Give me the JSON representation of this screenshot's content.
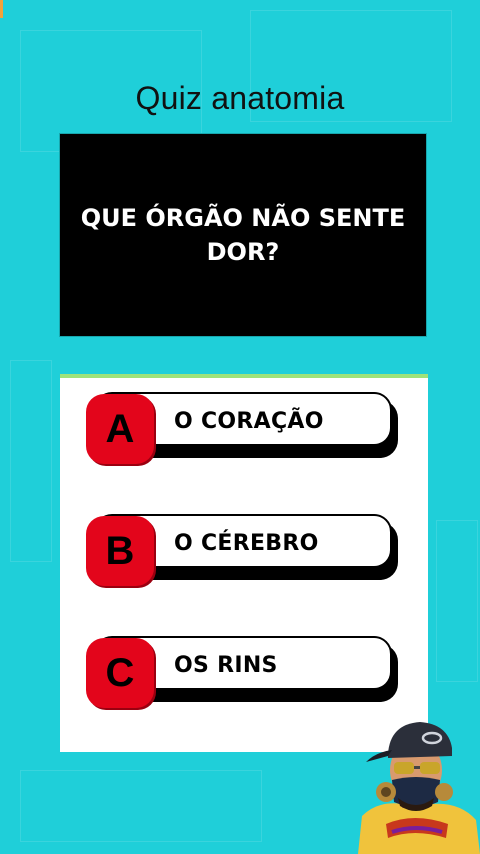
{
  "title": "Quiz anatomia",
  "question": "QUE ÓRGÃO NÃO SENTE DOR?",
  "options": [
    {
      "letter": "A",
      "text": "O CORAÇÃO"
    },
    {
      "letter": "B",
      "text": "O CÉREBRO"
    },
    {
      "letter": "C",
      "text": "OS RINS"
    }
  ],
  "mascot": {
    "icon": "character-with-cap-and-mask-icon"
  },
  "colors": {
    "background": "#1fcfd9",
    "letter_badge": "#e3051b",
    "question_bg": "#000000"
  }
}
